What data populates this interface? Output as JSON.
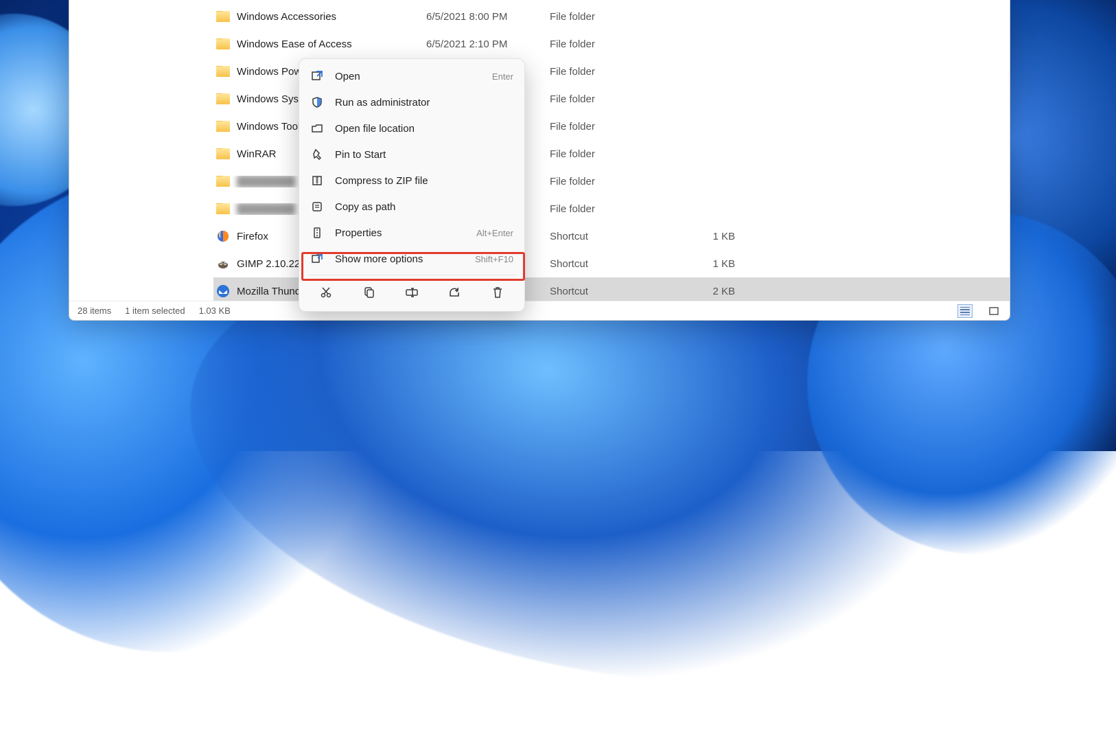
{
  "files": [
    {
      "name": "Windows Accessories",
      "icon": "folder",
      "date": "6/5/2021 8:00 PM",
      "type": "File folder",
      "size": ""
    },
    {
      "name": "Windows Ease of Access",
      "icon": "folder",
      "date": "6/5/2021 2:10 PM",
      "type": "File folder",
      "size": ""
    },
    {
      "name": "Windows PowerShell",
      "icon": "folder",
      "date": "",
      "type": "File folder",
      "size": "",
      "clip": "Windows Powe"
    },
    {
      "name": "Windows System",
      "icon": "folder",
      "date": "",
      "type": "File folder",
      "size": "",
      "clip": "Windows Syste"
    },
    {
      "name": "Windows Tools",
      "icon": "folder",
      "date": "",
      "type": "File folder",
      "size": ""
    },
    {
      "name": "WinRAR",
      "icon": "folder",
      "date": "",
      "type": "File folder",
      "size": ""
    },
    {
      "name": "",
      "icon": "folder",
      "date": "",
      "type": "File folder",
      "size": "",
      "blur": true
    },
    {
      "name": "",
      "icon": "folder",
      "date": "",
      "type": "File folder",
      "size": "",
      "blur": true
    },
    {
      "name": "Firefox",
      "icon": "firefox",
      "date": "",
      "type": "Shortcut",
      "size": "1 KB"
    },
    {
      "name": "GIMP 2.10.22",
      "icon": "gimp",
      "date": "",
      "type": "Shortcut",
      "size": "1 KB"
    },
    {
      "name": "Mozilla Thunderbird",
      "icon": "thunder",
      "date": "",
      "type": "Shortcut",
      "size": "2 KB",
      "clip": "Mozilla Thunde",
      "selected": true
    }
  ],
  "context_menu": {
    "items": [
      {
        "icon": "open",
        "label": "Open",
        "accel": "Enter"
      },
      {
        "icon": "admin",
        "label": "Run as administrator",
        "accel": ""
      },
      {
        "icon": "location",
        "label": "Open file location",
        "accel": ""
      },
      {
        "icon": "pin",
        "label": "Pin to Start",
        "accel": ""
      },
      {
        "icon": "zip",
        "label": "Compress to ZIP file",
        "accel": ""
      },
      {
        "icon": "path",
        "label": "Copy as path",
        "accel": ""
      },
      {
        "icon": "props",
        "label": "Properties",
        "accel": "Alt+Enter"
      },
      {
        "icon": "more",
        "label": "Show more options",
        "accel": "Shift+F10"
      }
    ],
    "actions": [
      "cut",
      "copy",
      "rename",
      "share",
      "delete"
    ]
  },
  "status": {
    "items": "28 items",
    "selected": "1 item selected",
    "size": "1.03 KB"
  }
}
